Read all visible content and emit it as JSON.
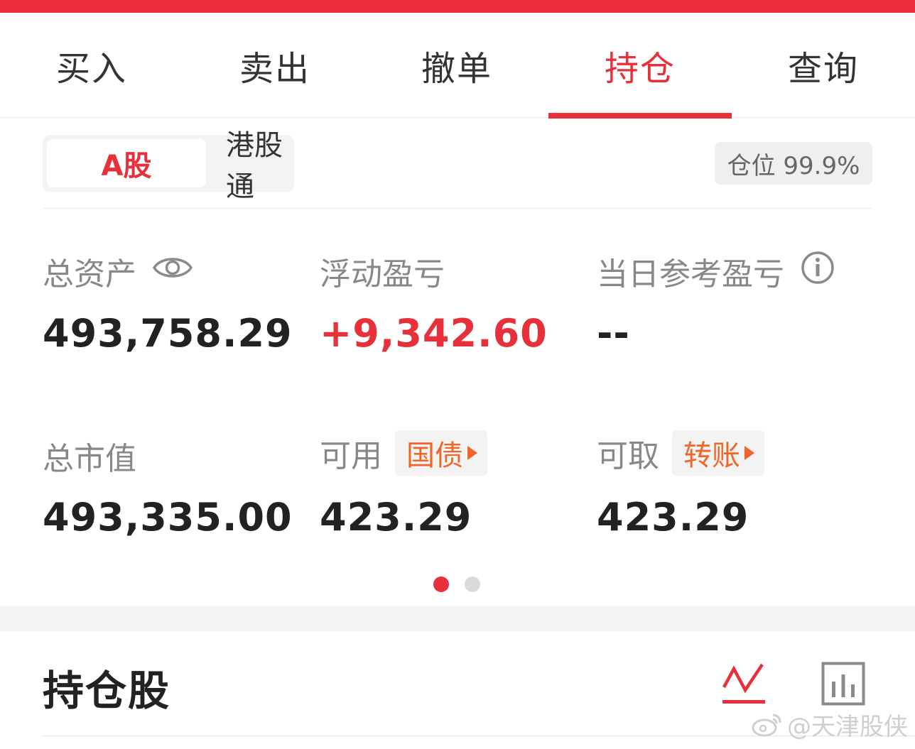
{
  "colors": {
    "accent": "#e8303a",
    "orange": "#f0662a",
    "top_bar": "#ee2e3a"
  },
  "tabs": [
    {
      "label": "买入"
    },
    {
      "label": "卖出"
    },
    {
      "label": "撤单"
    },
    {
      "label": "持仓",
      "active": true
    },
    {
      "label": "查询"
    }
  ],
  "market_switch": {
    "a_share": "A股",
    "hk_connect": "港股通",
    "selected": "A股"
  },
  "position_badge": "仓位 99.9%",
  "stats": {
    "total_assets": {
      "label": "总资产",
      "value": "493,758.29",
      "icon": "eye-icon"
    },
    "floating_pnl": {
      "label": "浮动盈亏",
      "value": "+9,342.60"
    },
    "daily_pnl": {
      "label": "当日参考盈亏",
      "value": "--",
      "icon": "info-icon"
    },
    "market_value": {
      "label": "总市值",
      "value": "493,335.00"
    },
    "available": {
      "label": "可用",
      "chip": "国债",
      "value": "423.29"
    },
    "withdrawable": {
      "label": "可取",
      "chip": "转账",
      "value": "423.29"
    }
  },
  "pager": {
    "pages": 2,
    "current": 1
  },
  "holdings": {
    "title": "持仓股",
    "icons": [
      "trend-line-icon",
      "bar-chart-icon"
    ]
  },
  "watermark": {
    "text": "@天津股侠",
    "icon": "weibo-icon"
  }
}
